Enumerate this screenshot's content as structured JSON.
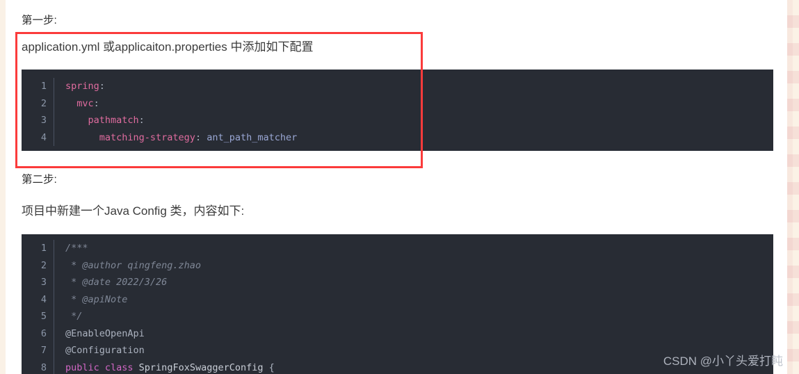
{
  "document": {
    "step1_label": "第一步:",
    "step1_headline": "application.yml 或applicaiton.properties 中添加如下配置",
    "step2_label": "第二步:",
    "step2_intro": "项目中新建一个Java Config 类，内容如下:"
  },
  "annotation": {
    "color": "#fb3b3b",
    "shape": "rectangle"
  },
  "code_block_1": {
    "language": "yaml",
    "background": "#282c34",
    "lines": [
      {
        "number": "1",
        "tokens": [
          {
            "text": "spring",
            "type": "key"
          },
          {
            "text": ":",
            "type": "punct"
          }
        ]
      },
      {
        "number": "2",
        "tokens": [
          {
            "text": "  mvc",
            "type": "key"
          },
          {
            "text": ":",
            "type": "punct"
          }
        ]
      },
      {
        "number": "3",
        "tokens": [
          {
            "text": "    pathmatch",
            "type": "key"
          },
          {
            "text": ":",
            "type": "punct"
          }
        ]
      },
      {
        "number": "4",
        "tokens": [
          {
            "text": "      matching-strategy",
            "type": "key"
          },
          {
            "text": ":",
            "type": "punct"
          },
          {
            "text": " ant_path_matcher",
            "type": "val"
          }
        ]
      }
    ]
  },
  "code_block_2": {
    "language": "java",
    "background": "#282c34",
    "lines": [
      {
        "number": "1",
        "tokens": [
          {
            "text": "/***",
            "type": "comment"
          }
        ]
      },
      {
        "number": "2",
        "tokens": [
          {
            "text": " * @author qingfeng.zhao",
            "type": "comment"
          }
        ]
      },
      {
        "number": "3",
        "tokens": [
          {
            "text": " * @date 2022/3/26",
            "type": "comment"
          }
        ]
      },
      {
        "number": "4",
        "tokens": [
          {
            "text": " * @apiNote",
            "type": "comment"
          }
        ]
      },
      {
        "number": "5",
        "tokens": [
          {
            "text": " */",
            "type": "comment"
          }
        ]
      },
      {
        "number": "6",
        "tokens": [
          {
            "text": "@EnableOpenApi",
            "type": "anno"
          }
        ]
      },
      {
        "number": "7",
        "tokens": [
          {
            "text": "@Configuration",
            "type": "anno"
          }
        ]
      },
      {
        "number": "8",
        "tokens": [
          {
            "text": "public class",
            "type": "kw"
          },
          {
            "text": " SpringFoxSwaggerConfig ",
            "type": "type"
          },
          {
            "text": "{",
            "type": "brace"
          }
        ]
      }
    ]
  },
  "watermark": {
    "text": "CSDN @小丫头爱打盹"
  }
}
